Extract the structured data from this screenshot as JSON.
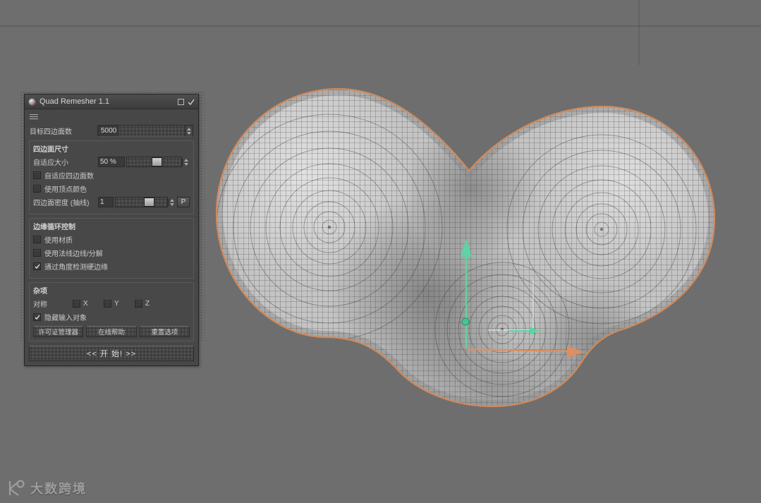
{
  "window": {
    "title": "Quad Remesher 1.1"
  },
  "panel": {
    "target_quad_count": {
      "label": "目标四边面数",
      "value": "5000"
    },
    "quad_size_group": {
      "title": "四边面尺寸",
      "adaptive_size": {
        "label": "自适应大小",
        "value": "50 %"
      },
      "adaptive_quad_count": {
        "label": "自适应四边面数",
        "checked": false
      },
      "use_vertex_colors": {
        "label": "使用顶点颜色",
        "checked": false
      },
      "quad_density": {
        "label": "四边面密度 (抽线)",
        "value": "1",
        "paint_button": "P"
      }
    },
    "edge_loops_group": {
      "title": "边缘循环控制",
      "use_materials": {
        "label": "使用材质",
        "checked": false
      },
      "use_normals_splitting": {
        "label": "使用法线边线/分解",
        "checked": false
      },
      "detect_hard_edges": {
        "label": "通过角度检测硬边缘",
        "checked": true
      }
    },
    "misc_group": {
      "title": "杂项",
      "symmetry_label": "对称",
      "symmetry_axes": [
        "X",
        "Y",
        "Z"
      ],
      "hide_input_object": {
        "label": "隐藏输入对象",
        "checked": true
      },
      "license_button": "许可证管理器",
      "help_button": "在线帮助",
      "reset_button": "重置选项"
    },
    "remesh_button": "<< 开  始! >>"
  },
  "watermark": {
    "text": "大数跨境"
  },
  "colors": {
    "viewport_bg": "#6e6e6e",
    "panel_bg": "#474747",
    "selection_outline": "#d08a5c",
    "axis_y_green": "#5fd3a3",
    "axis_x_orange": "#dd8f63",
    "mesh_fill": "#c4c4c4",
    "wireframe": "#2e2e2e"
  }
}
